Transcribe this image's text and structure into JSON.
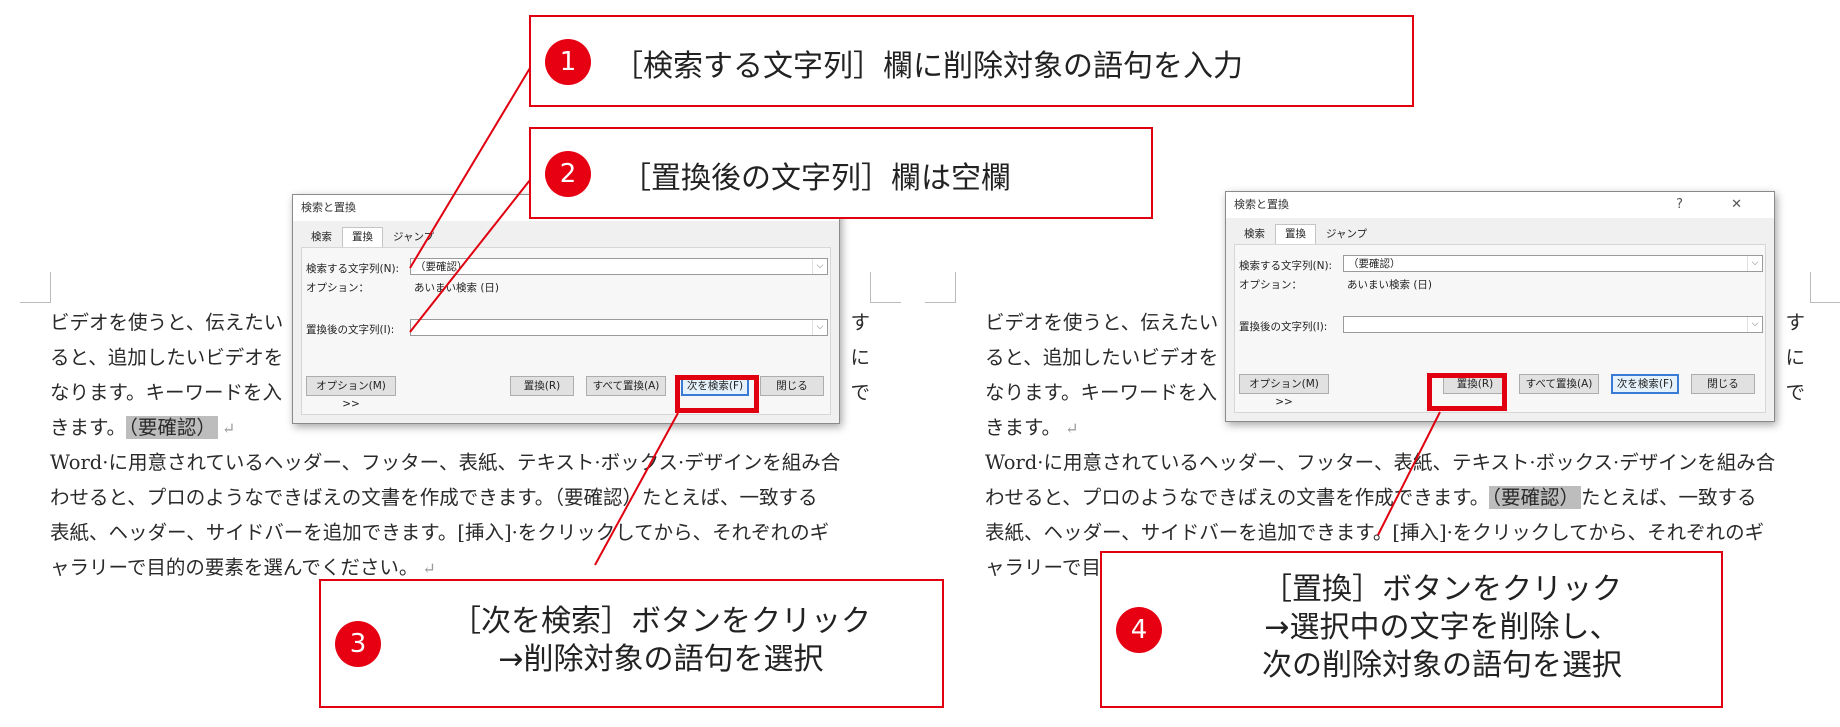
{
  "left_doc": {
    "lines": [
      {
        "before": "ビデオを使うと、伝えたい",
        "hl": "",
        "after": "",
        "right": "す"
      },
      {
        "before": "ると、追加したいビデオを",
        "hl": "",
        "after": "",
        "right": "に"
      },
      {
        "before": "なります。キーワードを入",
        "hl": "",
        "after": "",
        "right": "で"
      },
      {
        "before": "きます。",
        "hl": "（要確認）",
        "after": "",
        "right": ""
      },
      {
        "before": "Word·に用意されているヘッダー、フッター、表紙、テキスト·ボックス·デザインを組み合",
        "hl": "",
        "after": "",
        "right": ""
      },
      {
        "before": "わせると、プロのようなできばえの文書を作成できます。（要確認）たとえば、一致する",
        "hl": "",
        "after": "",
        "right": ""
      },
      {
        "before": "表紙、ヘッダー、サイドバーを追加できます。[挿入]·をクリックしてから、それぞれのギ",
        "hl": "",
        "after": "",
        "right": ""
      },
      {
        "before": "ャラリーで目的の要素を選んでください。",
        "hl": "",
        "after": "",
        "right": ""
      }
    ]
  },
  "right_doc": {
    "lines": [
      {
        "before": "ビデオを使うと、伝えたい",
        "hl": "",
        "after": "",
        "right": "す"
      },
      {
        "before": "ると、追加したいビデオを",
        "hl": "",
        "after": "",
        "right": "に"
      },
      {
        "before": "なります。キーワードを入",
        "hl": "",
        "after": "",
        "right": "で"
      },
      {
        "before": "きます。",
        "hl": "",
        "after": "",
        "right": ""
      },
      {
        "before": "Word·に用意されているヘッダー、フッター、表紙、テキスト·ボックス·デザインを組み合",
        "hl": "",
        "after": "",
        "right": ""
      },
      {
        "before": "わせると、プロのようなできばえの文書を作成できます。",
        "hl": "（要確認）",
        "after": "たとえば、一致する",
        "right": ""
      },
      {
        "before": "表紙、ヘッダー、サイドバーを追加できます。[挿入]·をクリックしてから、それぞれのギ",
        "hl": "",
        "after": "",
        "right": ""
      },
      {
        "before": "ャラリーで目",
        "hl": "",
        "after": "",
        "right": ""
      }
    ]
  },
  "paragraph_mark": "↵",
  "dialog": {
    "title": "検索と置換",
    "title_buttons": "? ✕",
    "tabs": [
      "検索",
      "置換",
      "ジャンプ"
    ],
    "find_label": "検索する文字列(N):",
    "find_value": "（要確認）",
    "options_label": "オプション：",
    "options_value": "あいまい検索 (日)",
    "replace_label": "置換後の文字列(I):",
    "replace_value": "",
    "more_button": "オプション(M) >>",
    "replace_button": "置換(R)",
    "replace_all_button": "すべて置換(A)",
    "find_next_button": "次を検索(F)",
    "close_button": "閉じる",
    "dropdown_glyph": "⌵"
  },
  "callouts": {
    "c1": {
      "num": "1",
      "text": "［検索する文字列］欄に削除対象の語句を入力"
    },
    "c2": {
      "num": "2",
      "text": "［置換後の文字列］欄は空欄"
    },
    "c3": {
      "num": "3",
      "line1": "［次を検索］ボタンをクリック",
      "line2": "→削除対象の語句を選択"
    },
    "c4": {
      "num": "4",
      "line1": "［置換］ボタンをクリック",
      "line2": "→選択中の文字を削除し、",
      "line3": "次の削除対象の語句を選択"
    }
  },
  "colors": {
    "accent_red": "#e0000f",
    "highlight_gray": "#bdbdbd",
    "default_button_blue": "#3a7bd5"
  }
}
